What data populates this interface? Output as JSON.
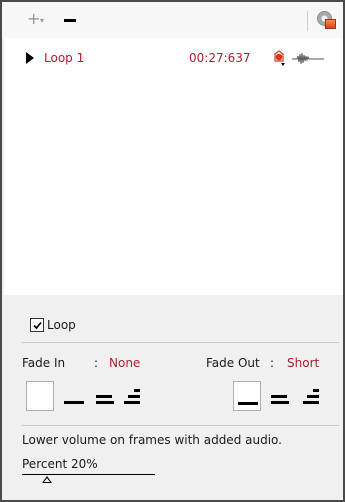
{
  "toolbar": {
    "add_icon": "plus-dropdown-icon",
    "remove_icon": "minus-icon",
    "settings_icon": "gear-settings-icon"
  },
  "loops": [
    {
      "name": "Loop 1",
      "time": "00:27:637",
      "icons": [
        "play-icon",
        "record-icon",
        "waveform-icon"
      ]
    }
  ],
  "options": {
    "loop_label": "Loop",
    "loop_checked": true,
    "fade_in_label": "Fade In",
    "fade_in_colon": ":",
    "fade_in_value": "None",
    "fade_out_label": "Fade Out",
    "fade_out_colon": ":",
    "fade_out_value": "Short",
    "fade_in_options": [
      "none",
      "short",
      "medium",
      "long"
    ],
    "fade_out_options": [
      "short",
      "medium",
      "long"
    ],
    "lower_volume_text": "Lower volume on frames with added audio.",
    "percent_label": "Percent 20%",
    "percent_value": 20
  },
  "colors": {
    "accent_red": "#b01e2e",
    "panel_bg": "#f0f0f0",
    "list_bg": "#ffffff"
  }
}
